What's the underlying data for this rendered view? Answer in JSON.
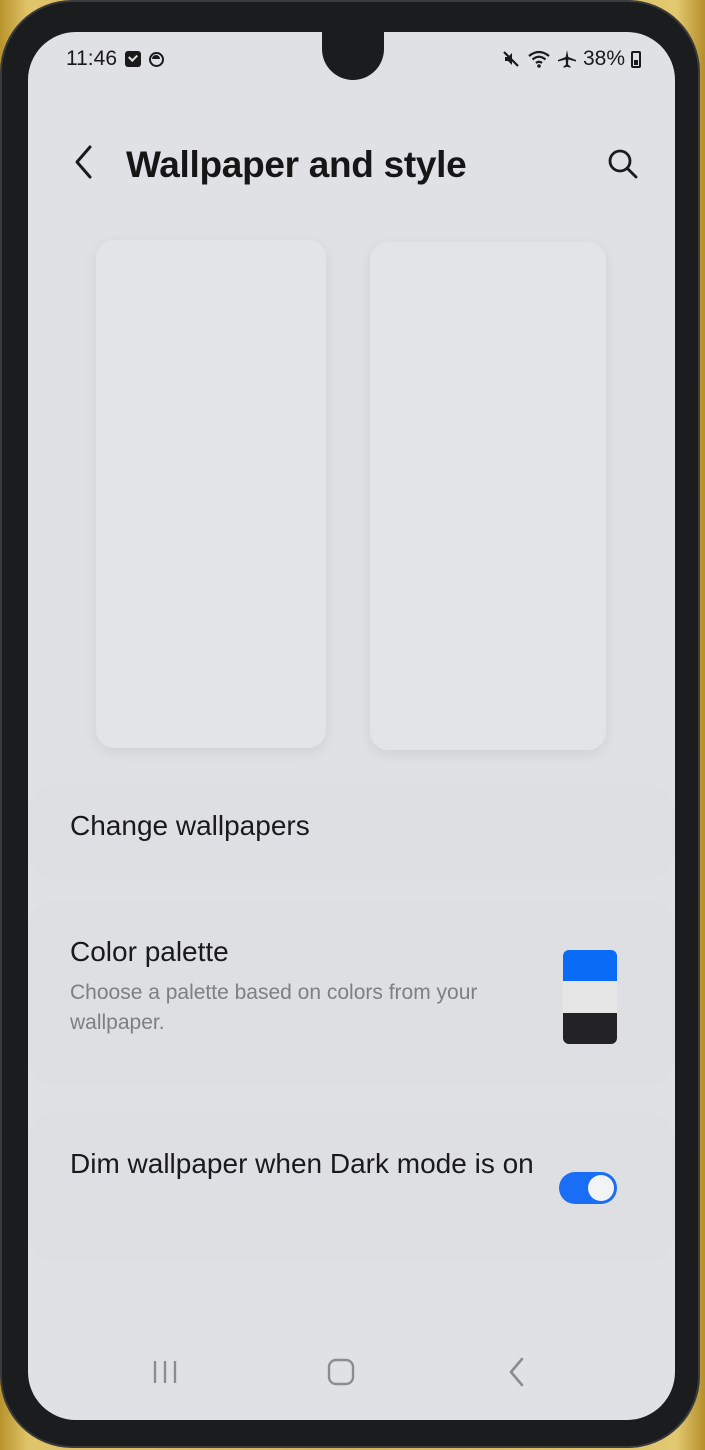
{
  "status_bar": {
    "time": "11:46",
    "battery_text": "38%",
    "battery_level": 0.38,
    "icons": [
      "checkbox-notification-icon",
      "vpn-circle-icon",
      "mute-icon",
      "wifi-icon",
      "airplane-icon",
      "battery-icon"
    ]
  },
  "header": {
    "title": "Wallpaper and style",
    "back_icon": "chevron-left-icon",
    "search_icon": "search-icon"
  },
  "previews": {
    "lock_screen": "lock-screen-preview",
    "home_screen": "home-screen-preview"
  },
  "settings": {
    "change_wallpapers": {
      "title": "Change wallpapers"
    },
    "color_palette": {
      "title": "Color palette",
      "subtitle": "Choose a palette based on colors from your wallpaper.",
      "swatch_colors": [
        "#0a6cf6",
        "#e6e6e6",
        "#232325"
      ]
    },
    "dim_wallpaper": {
      "title": "Dim wallpaper when Dark mode is on",
      "enabled": true,
      "toggle_color": "#1a6ef5"
    }
  },
  "nav_bar": {
    "recents_icon": "recents-icon",
    "home_icon": "home-icon",
    "back_icon": "back-icon"
  },
  "colors": {
    "screen_bg": "#dfe1e4",
    "accent": "#1a6ef5",
    "text_primary": "#1a1a1a",
    "text_secondary": "#7d7f83"
  }
}
